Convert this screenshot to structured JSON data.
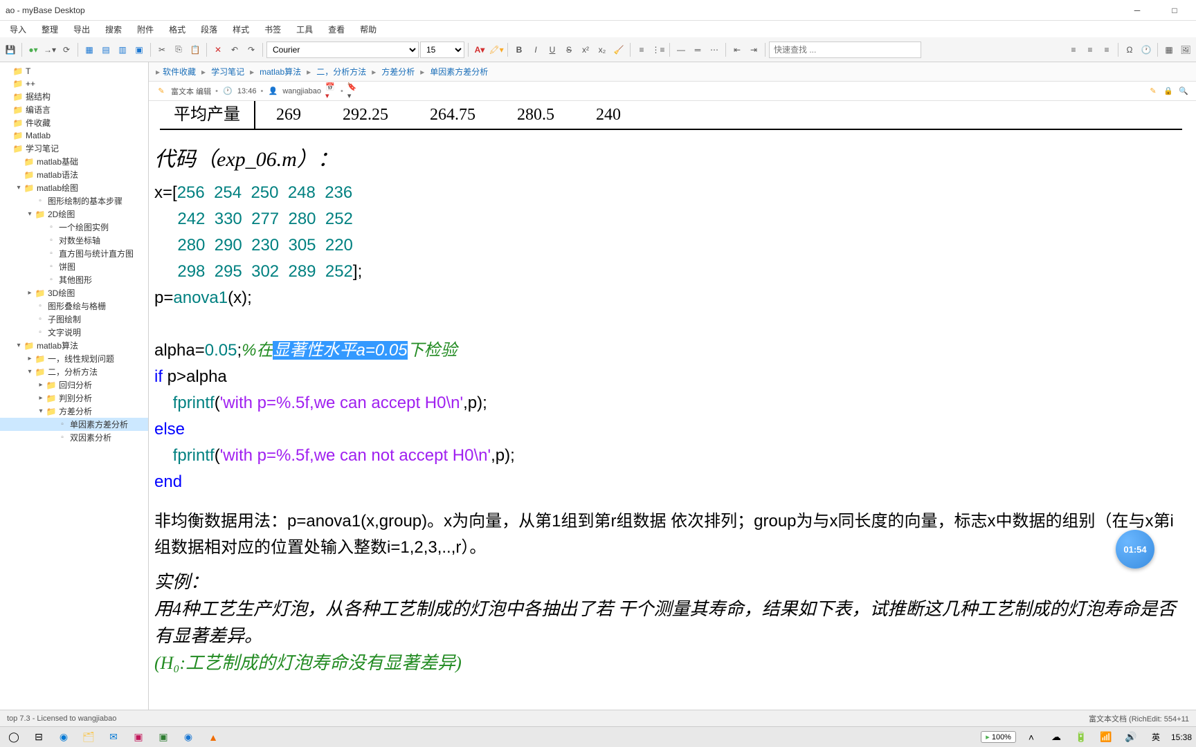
{
  "window": {
    "title": "ao - myBase Desktop"
  },
  "menubar": [
    "导入",
    "整理",
    "导出",
    "搜索",
    "附件",
    "格式",
    "段落",
    "样式",
    "书签",
    "工具",
    "查看",
    "帮助"
  ],
  "toolbar": {
    "font": "Courier",
    "font_size": "15",
    "search_placeholder": "快速查找 ..."
  },
  "sidebar": {
    "items": [
      {
        "label": "T",
        "depth": 0,
        "type": "folder",
        "expand": ""
      },
      {
        "label": "++",
        "depth": 0,
        "type": "folder",
        "expand": ""
      },
      {
        "label": "据结构",
        "depth": 0,
        "type": "folder",
        "expand": ""
      },
      {
        "label": "编语言",
        "depth": 0,
        "type": "folder",
        "expand": ""
      },
      {
        "label": "件收藏",
        "depth": 0,
        "type": "folder",
        "expand": ""
      },
      {
        "label": "Matlab",
        "depth": 0,
        "type": "folder",
        "expand": ""
      },
      {
        "label": "学习笔记",
        "depth": 0,
        "type": "folder",
        "expand": ""
      },
      {
        "label": "matlab基础",
        "depth": 1,
        "type": "folder",
        "expand": ""
      },
      {
        "label": "matlab语法",
        "depth": 1,
        "type": "folder",
        "expand": ""
      },
      {
        "label": "matlab绘图",
        "depth": 1,
        "type": "folder",
        "expand": "▾"
      },
      {
        "label": "图形绘制的基本步骤",
        "depth": 2,
        "type": "doc",
        "expand": ""
      },
      {
        "label": "2D绘图",
        "depth": 2,
        "type": "folder",
        "expand": "▾"
      },
      {
        "label": "一个绘图实例",
        "depth": 3,
        "type": "doc",
        "expand": ""
      },
      {
        "label": "对数坐标轴",
        "depth": 3,
        "type": "doc",
        "expand": ""
      },
      {
        "label": "直方图与统计直方图",
        "depth": 3,
        "type": "doc",
        "expand": ""
      },
      {
        "label": "饼图",
        "depth": 3,
        "type": "doc",
        "expand": ""
      },
      {
        "label": "其他图形",
        "depth": 3,
        "type": "doc",
        "expand": ""
      },
      {
        "label": "3D绘图",
        "depth": 2,
        "type": "folder",
        "expand": "▸"
      },
      {
        "label": "图形叠绘与格栅",
        "depth": 2,
        "type": "doc",
        "expand": ""
      },
      {
        "label": "子图绘制",
        "depth": 2,
        "type": "doc",
        "expand": ""
      },
      {
        "label": "文字说明",
        "depth": 2,
        "type": "doc",
        "expand": ""
      },
      {
        "label": "matlab算法",
        "depth": 1,
        "type": "folder",
        "expand": "▾"
      },
      {
        "label": "一，线性规划问题",
        "depth": 2,
        "type": "folder",
        "expand": "▸"
      },
      {
        "label": "二，分析方法",
        "depth": 2,
        "type": "folder",
        "expand": "▾"
      },
      {
        "label": "回归分析",
        "depth": 3,
        "type": "folder",
        "expand": "▸"
      },
      {
        "label": "判别分析",
        "depth": 3,
        "type": "folder",
        "expand": "▸"
      },
      {
        "label": "方差分析",
        "depth": 3,
        "type": "folder",
        "expand": "▾"
      },
      {
        "label": "单因素方差分析",
        "depth": 4,
        "type": "doc",
        "expand": "",
        "selected": true
      },
      {
        "label": "双因素分析",
        "depth": 4,
        "type": "doc",
        "expand": ""
      }
    ]
  },
  "breadcrumb": [
    "软件收藏",
    "学习笔记",
    "matlab算法",
    "二，分析方法",
    "方差分析",
    "单因素方差分析"
  ],
  "infobar": {
    "mode": "富文本 编辑",
    "time": "13:46",
    "user": "wangjiabao"
  },
  "doc": {
    "avg_row": {
      "label": "平均产量",
      "values": [
        "269",
        "292.25",
        "264.75",
        "280.5",
        "240"
      ]
    },
    "code_title": "代码（exp_06.m）：",
    "code": {
      "l1a": "x=[",
      "l1b": "256  254  250  248  236",
      "l2": "     242  330  277  280  252",
      "l3": "     280  290  230  305  220",
      "l4a": "     298  295  302  289  252",
      "l4b": "];",
      "l5a": "p=",
      "l5b": "anova1",
      "l5c": "(x);",
      "blank": "",
      "l6a": "alpha=",
      "l6b": "0.05",
      "l6c": ";",
      "l6d": "%在",
      "l6e": "显著性水平a=0.05",
      "l6f": "下检验",
      "l7a": "if ",
      "l7b": "p>alpha",
      "l8a": "    fprintf",
      "l8b": "(",
      "l8c": "'with p=%.5f,we can accept H0\\n'",
      "l8d": ",p);",
      "l9": "else",
      "l10a": "    fprintf",
      "l10b": "(",
      "l10c": "'with p=%.5f,we can not accept H0\\n'",
      "l10d": ",p);",
      "l11": "end"
    },
    "para1": "非均衡数据用法：p=anova1(x,group)。x为向量，从第1组到第r组数据 依次排列；group为与x同长度的向量，标志x中数据的组别（在与x第i 组数据相对应的位置处输入整数i=1,2,3,..,r）。",
    "example_title": "实例：",
    "example_body": "用4种工艺生产灯泡，从各种工艺制成的灯泡中各抽出了若 干个测量其寿命，结果如下表，试推断这几种工艺制成的灯泡寿命是否 有显著差异。",
    "hypothesis": "(H₀:工艺制成的灯泡寿命没有显著差异)"
  },
  "statusbar": {
    "left": "top 7.3 - Licensed to wangjiabao",
    "right": "富文本文档 (RichEdit: 554+11"
  },
  "taskbar": {
    "zoom": "100%",
    "ime": "英",
    "time": "15:38"
  },
  "clock": "01:54"
}
